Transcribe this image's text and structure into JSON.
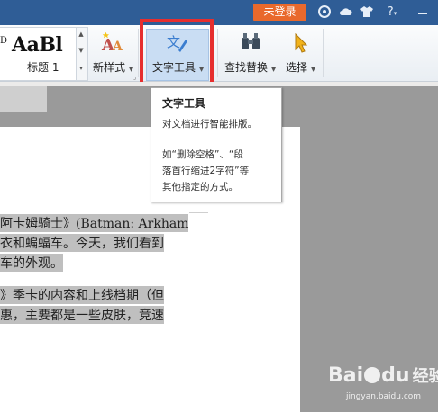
{
  "titlebar": {
    "login_label": "未登录",
    "icons": [
      "shield-icon",
      "cloud-icon",
      "shirt-icon",
      "help-icon",
      "minimize-icon"
    ],
    "help_glyph": "?"
  },
  "ribbon": {
    "style_preview_text": "AaBl",
    "style_preview_small": "D",
    "style_caption": "标题 1",
    "new_style_label": "新样式",
    "text_tool_label": "文字工具",
    "find_replace_label": "查找替换",
    "select_label": "选择"
  },
  "tooltip": {
    "title": "文字工具",
    "desc": "对文档进行智能排版。",
    "lines": [
      "如“删除空格”、“段",
      "落首行缩进2字符”等",
      "其他指定的方式。"
    ]
  },
  "document": {
    "lines": [
      "阿卡姆骑士》(Batman: Arkham",
      "衣和蝙蝠车。今天，我们看到",
      "车的外观。",
      "》季卡的内容和上线档期（但",
      "惠，主要都是一些皮肤，竞速"
    ]
  },
  "watermark": {
    "brand": "Bai",
    "logo": "du",
    "suffix": "经验",
    "url": "jingyan.baidu.com"
  },
  "colors": {
    "titlebar": "#2f5d96",
    "login": "#e9692c",
    "highlight_box": "#e62e2e",
    "selection": "#bfbfbf"
  }
}
